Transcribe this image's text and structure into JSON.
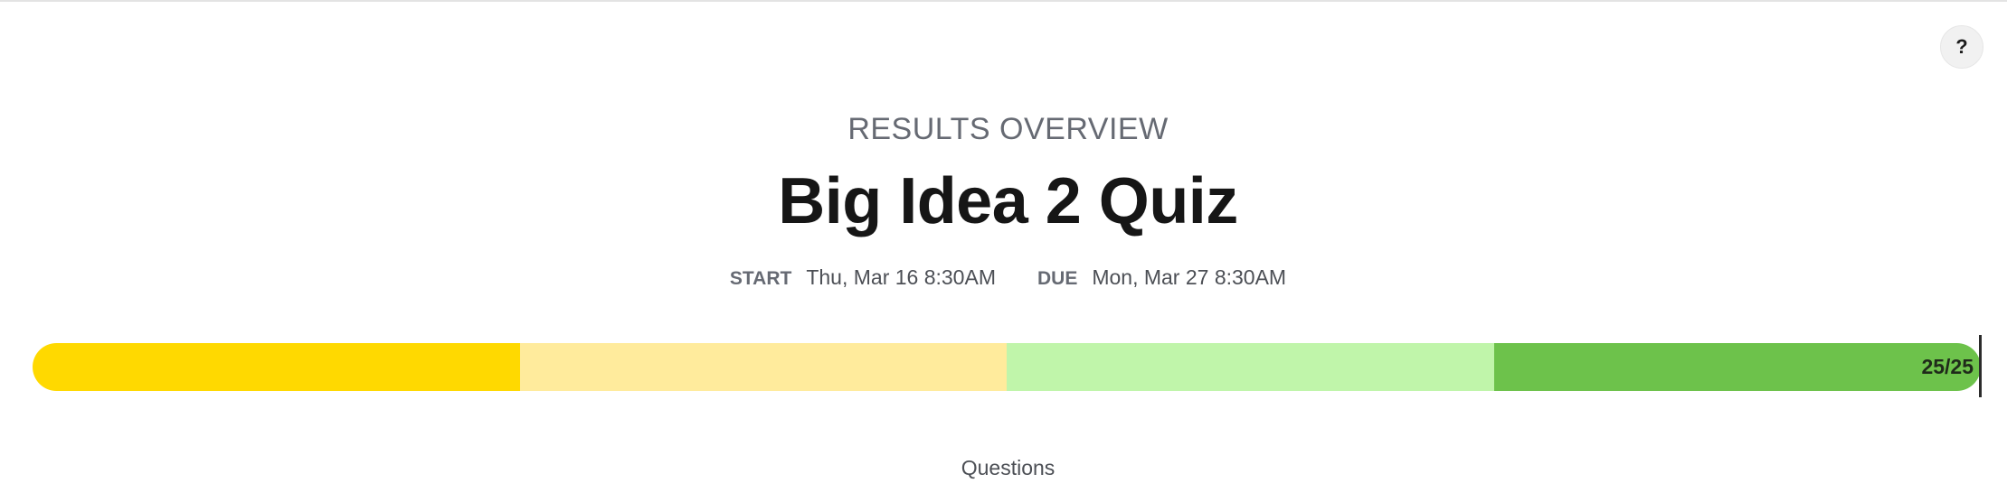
{
  "header": {
    "help_label": "?",
    "subtitle": "RESULTS OVERVIEW",
    "title": "Big Idea 2 Quiz"
  },
  "dates": {
    "start_label": "START",
    "start_value": "Thu, Mar 16 8:30AM",
    "due_label": "DUE",
    "due_value": "Mon, Mar 27 8:30AM"
  },
  "progress": {
    "score_text": "25/25",
    "correct": 25,
    "total": 25,
    "segment_colors": [
      "#ffd900",
      "#ffeb9c",
      "#c0f5aa",
      "#6dc24b"
    ]
  },
  "section": {
    "questions_label": "Questions"
  }
}
